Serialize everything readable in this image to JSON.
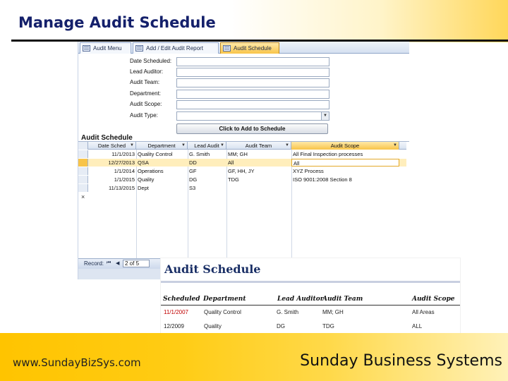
{
  "slide": {
    "title": "Manage Audit Schedule",
    "footer_url": "www.SundayBizSys.com",
    "footer_company": "Sunday Business Systems",
    "colors": {
      "title": "#14206b",
      "footer_gold": "#ffc400",
      "active_tab": "#f8c449"
    }
  },
  "access": {
    "tabs": [
      {
        "label": "Audit Menu",
        "icon": "form-icon"
      },
      {
        "label": "Add / Edit Audit Report",
        "icon": "form-icon"
      },
      {
        "label": "Audit Schedule",
        "icon": "form-icon",
        "active": true
      }
    ],
    "form": {
      "fields": [
        {
          "label": "Date Scheduled:",
          "value": ""
        },
        {
          "label": "Lead Auditor:",
          "value": ""
        },
        {
          "label": "Audit Team:",
          "value": ""
        },
        {
          "label": "Department:",
          "value": ""
        },
        {
          "label": "Audit Scope:",
          "value": ""
        },
        {
          "label": "Audit Type:",
          "value": "",
          "dropdown": true
        }
      ],
      "add_button": "Click to Add to Schedule"
    },
    "subform_title": "Audit Schedule",
    "datasheet": {
      "columns": [
        "Date Sched",
        "Department",
        "Lead Audit",
        "Audit Team",
        "Audit Scope"
      ],
      "rows": [
        [
          "11/1/2013",
          "Quality Control",
          "G. Smith",
          "MM; GH",
          "All Final Inspection processes"
        ],
        [
          "12/27/2013",
          "QSA",
          "DD",
          "All",
          "All"
        ],
        [
          "1/1/2014",
          "Operations",
          "GF",
          "GF, HH, JY",
          "XYZ Process"
        ],
        [
          "1/1/2015",
          "Quality",
          "DG",
          "TDG",
          "ISO 9001:2008 Section 8"
        ],
        [
          "11/13/2015",
          "Dept",
          "S3",
          "",
          ""
        ]
      ],
      "selected_row": 1,
      "new_row_marker": "×"
    },
    "nav": {
      "label": "Record:",
      "first": "⏮",
      "prev": "◀",
      "record_value": "2 of 5"
    }
  },
  "report": {
    "title": "Audit Schedule",
    "headers": [
      "Scheduled",
      "Department",
      "Lead Auditor",
      "Audit Team",
      "Audit Scope"
    ],
    "rows": [
      [
        "11/1/2007",
        "Quality Control",
        "G. Smith",
        "MM; GH",
        "All Areas"
      ],
      [
        "12/2009",
        "Quality",
        "DG",
        "TDG",
        "ALL"
      ]
    ]
  }
}
